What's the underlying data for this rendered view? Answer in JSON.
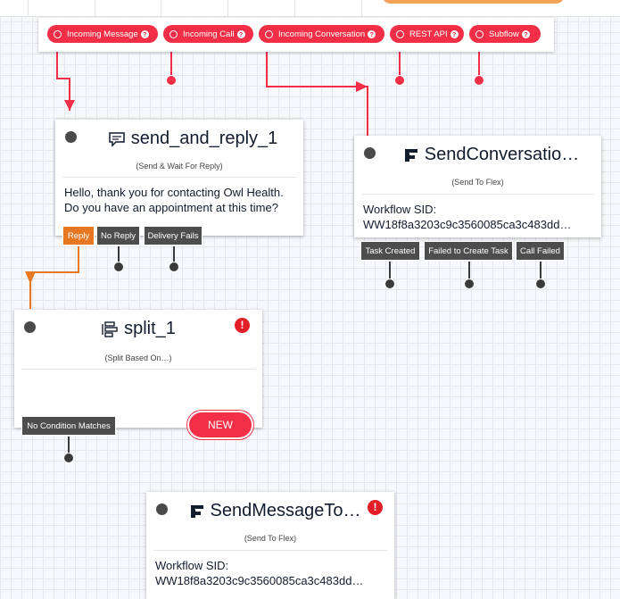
{
  "trigger": {
    "outputs": [
      {
        "label": "Incoming Message",
        "help": "?"
      },
      {
        "label": "Incoming Call",
        "help": "?"
      },
      {
        "label": "Incoming Conversation",
        "help": "?"
      },
      {
        "label": "REST API",
        "help": "?"
      },
      {
        "label": "Subflow",
        "help": "?"
      }
    ]
  },
  "widgets": {
    "send_and_reply": {
      "title": "send_and_reply_1",
      "type": "(Send & Wait For Reply)",
      "body": "Hello, thank you for contacting Owl Health. Do you have an appointment at this time?",
      "transitions": [
        "Reply",
        "No Reply",
        "Delivery Fails"
      ]
    },
    "send_conversation": {
      "title": "SendConversatio…",
      "type": "(Send To Flex)",
      "body_label": "Workflow SID:",
      "body_value": "WW18f8a3203c9c3560085ca3c483dd…",
      "transitions": [
        "Task Created",
        "Failed to Create Task",
        "Call Failed"
      ]
    },
    "split": {
      "title": "split_1",
      "type": "(Split Based On…)",
      "warning": "!",
      "transitions": [
        "No Condition Matches"
      ],
      "new_label": "NEW"
    },
    "send_message": {
      "title": "SendMessageTo…",
      "type": "(Send To Flex)",
      "warning": "!",
      "body_label": "Workflow SID:",
      "body_value": "WW18f8a3203c9c3560085ca3c483dd…"
    }
  },
  "colors": {
    "twilio_red": "#f22f46",
    "reply_orange": "#e87722",
    "transition_gray": "#4d4d4d",
    "warning_red": "#e31e26"
  },
  "icons": {
    "send_and_reply": "chat-bubble-icon",
    "send_to_flex": "flex-logo-icon",
    "split": "split-icon",
    "warning": "warning-icon"
  }
}
